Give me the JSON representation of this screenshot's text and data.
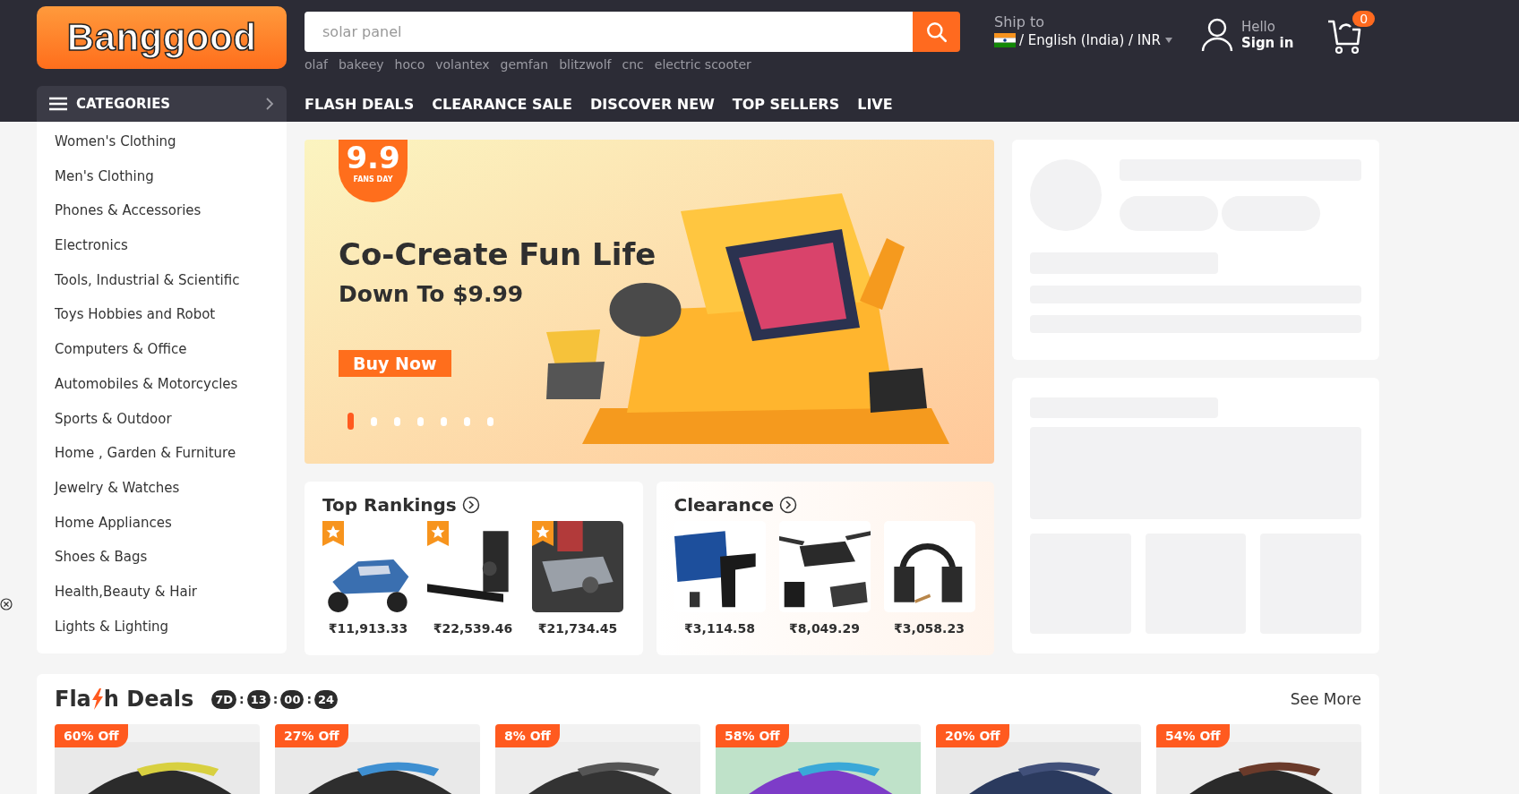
{
  "logo": {
    "text": "Banggood"
  },
  "search": {
    "placeholder": "solar panel"
  },
  "hot_searches": [
    "olaf",
    "bakeey",
    "hoco",
    "volantex",
    "gemfan",
    "blitzwolf",
    "cnc",
    "electric scooter"
  ],
  "ship_to": {
    "label": "Ship to",
    "value": "/ English (India) / INR"
  },
  "account": {
    "greeting": "Hello",
    "action": "Sign in"
  },
  "cart": {
    "count": "0"
  },
  "categories_button": {
    "label": "CATEGORIES"
  },
  "nav": [
    "FLASH DEALS",
    "CLEARANCE SALE",
    "DISCOVER NEW",
    "TOP SELLERS",
    "LIVE"
  ],
  "categories": [
    "Women's Clothing",
    "Men's Clothing",
    "Phones & Accessories",
    "Electronics",
    "Tools, Industrial & Scientific",
    "Toys Hobbies and Robot",
    "Computers & Office",
    "Automobiles & Motorcycles",
    "Sports & Outdoor",
    "Home , Garden & Furniture",
    "Jewelry & Watches",
    "Home Appliances",
    "Shoes & Bags",
    "Health,Beauty & Hair",
    "Lights & Lighting"
  ],
  "banner": {
    "badge_number": "9.9",
    "badge_label": "FANS DAY",
    "headline": "Co-Create Fun Life",
    "subline": "Down To $9.99",
    "button": "Buy Now",
    "dots": [
      {
        "selected": true
      },
      {
        "selected": false
      },
      {
        "selected": false
      },
      {
        "selected": false
      },
      {
        "selected": false
      },
      {
        "selected": false
      },
      {
        "selected": false
      }
    ]
  },
  "top_rankings": {
    "title": "Top Rankings",
    "items": [
      {
        "price": "₹11,913.33"
      },
      {
        "price": "₹22,539.46"
      },
      {
        "price": "₹21,734.45"
      }
    ]
  },
  "clearance": {
    "title": "Clearance",
    "items": [
      {
        "price": "₹3,114.58"
      },
      {
        "price": "₹8,049.29"
      },
      {
        "price": "₹3,058.23"
      }
    ]
  },
  "flash_deals": {
    "title_start": "Fla",
    "title_end": "h Deals",
    "countdown": [
      {
        "value": "7D",
        "separator": ":"
      },
      {
        "value": "13",
        "separator": ":"
      },
      {
        "value": "00",
        "separator": ":"
      },
      {
        "value": "24"
      }
    ],
    "see_more": "See More",
    "deals": [
      {
        "discount": "60% Off"
      },
      {
        "discount": "27% Off"
      },
      {
        "discount": "8% Off"
      },
      {
        "discount": "58% Off"
      },
      {
        "discount": "20% Off"
      },
      {
        "discount": "54% Off"
      }
    ]
  }
}
